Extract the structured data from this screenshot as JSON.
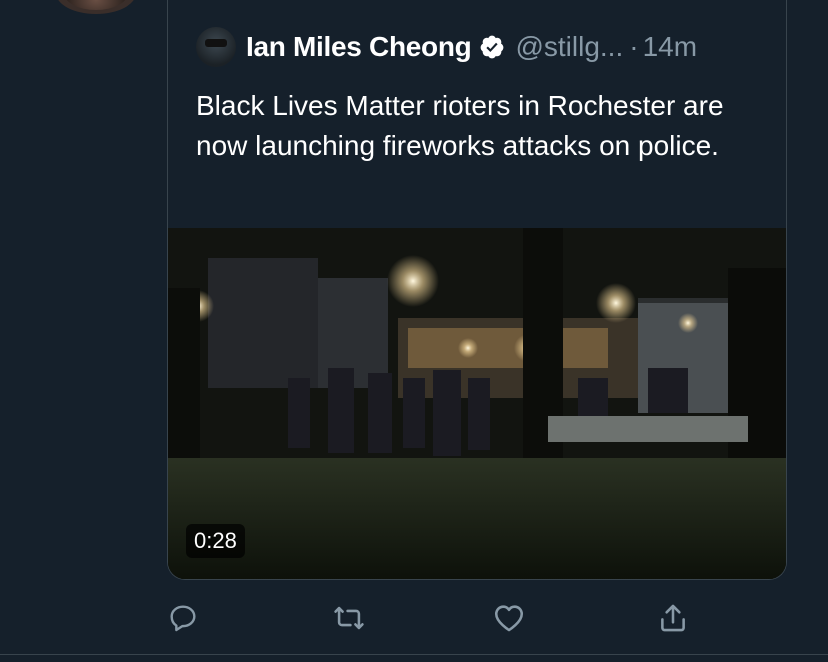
{
  "quoted_tweet": {
    "author_name": "Ian Miles Cheong",
    "author_handle": "@stillg...",
    "separator": "·",
    "timestamp": "14m",
    "text": "Black Lives Matter rioters in Rochester are now launching fireworks attacks on police.",
    "video": {
      "duration": "0:28"
    }
  },
  "actions": {
    "icons": [
      "reply-icon",
      "retweet-icon",
      "like-icon",
      "share-icon"
    ]
  },
  "colors": {
    "background": "#15202b",
    "border": "#38444d",
    "secondary_text": "#8899a6",
    "primary_text": "#ffffff"
  }
}
